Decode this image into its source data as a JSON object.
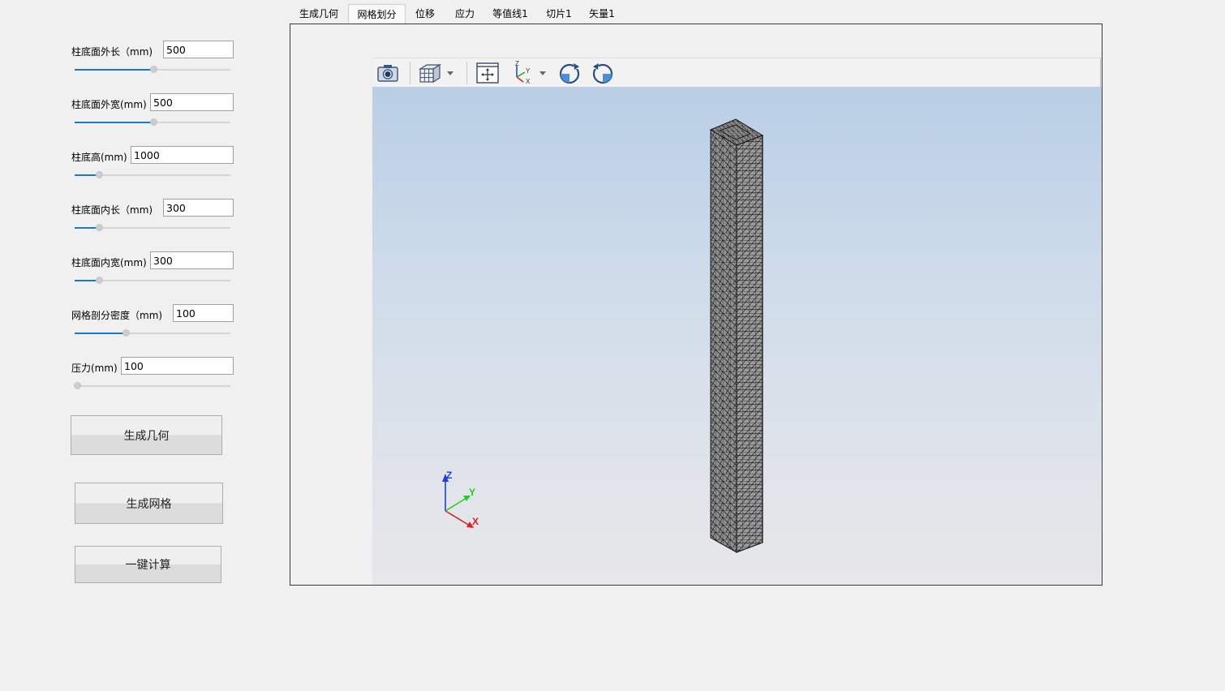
{
  "tabs": [
    {
      "label": "生成几何"
    },
    {
      "label": "网格划分"
    },
    {
      "label": "位移"
    },
    {
      "label": "应力"
    },
    {
      "label": "等值线1"
    },
    {
      "label": "切片1"
    },
    {
      "label": "矢量1"
    }
  ],
  "active_tab": 1,
  "params": [
    {
      "label": "柱底面外长（mm)",
      "value": "500",
      "slider": 0.5
    },
    {
      "label": "柱底面外宽(mm)",
      "value": "500",
      "slider": 0.5
    },
    {
      "label": "柱底高(mm)",
      "value": "1000",
      "slider": 0.15
    },
    {
      "label": "柱底面内长（mm)",
      "value": "300",
      "slider": 0.15
    },
    {
      "label": "柱底面内宽(mm)",
      "value": "300",
      "slider": 0.15
    },
    {
      "label": "网格剖分密度（mm)",
      "value": "100",
      "slider": 0.33
    },
    {
      "label": "压力(mm)",
      "value": "100",
      "slider": 0.0
    }
  ],
  "buttons": {
    "generate_geometry": "生成几何",
    "generate_mesh": "生成网格",
    "one_click_compute": "一键计算"
  },
  "toolbar": {
    "icons": [
      "camera-icon",
      "view-cube-icon",
      "fit-view-icon",
      "axes-orientation-icon",
      "rotate-cw-icon",
      "rotate-ccw-icon"
    ]
  },
  "viewer": {
    "axis_labels": {
      "z": "Z",
      "y": "Y",
      "x": "X"
    },
    "axis_colors": {
      "z": "#1f3de0",
      "y": "#22cc22",
      "x": "#e01f1f"
    },
    "mesh_fill": "#8e8e8e",
    "mesh_edges": "#1a1a1a"
  }
}
